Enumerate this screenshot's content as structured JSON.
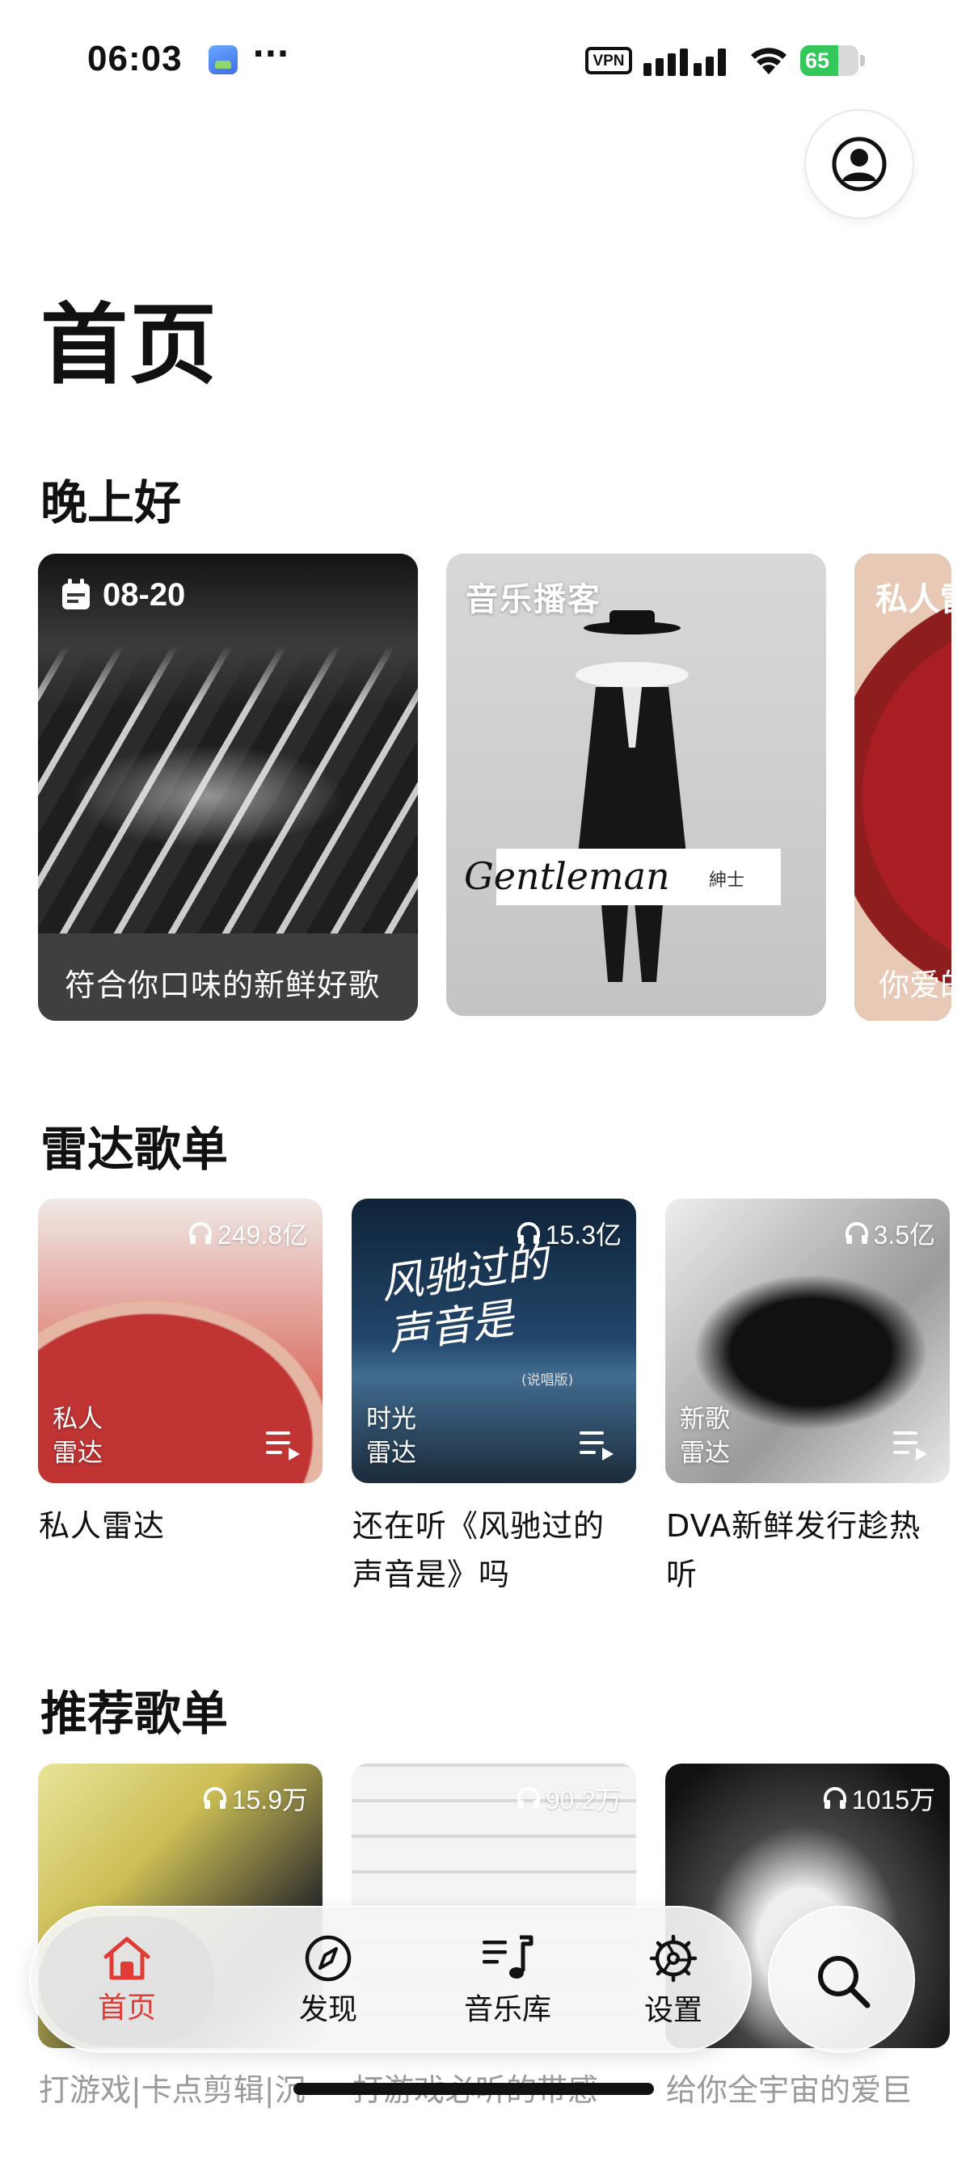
{
  "status_bar": {
    "time": "06:03",
    "more": "···",
    "vpn": "VPN",
    "battery_percent": 65,
    "battery_text": "65"
  },
  "header": {
    "title": "首页",
    "profile_icon": "person-circle-icon"
  },
  "greeting": {
    "title": "晚上好",
    "cards": [
      {
        "date": "08-20",
        "caption": "符合你口味的新鲜好歌"
      },
      {
        "label": "音乐播客",
        "art_text": "Gentleman",
        "art_text_cn": "紳士"
      },
      {
        "label": "私人雷达",
        "caption": "你爱的"
      }
    ]
  },
  "radar": {
    "title": "雷达歌单",
    "playlists": [
      {
        "plays": "249.8亿",
        "label_line1": "私人",
        "label_line2": "雷达",
        "title": "私人雷达"
      },
      {
        "plays": "15.3亿",
        "label_line1": "时光",
        "label_line2": "雷达",
        "title": "还在听《风驰过的声音是》吗",
        "art_line1": "风驰过的",
        "art_line2": "声音是",
        "art_note": "(说唱版)"
      },
      {
        "plays": "3.5亿",
        "label_line1": "新歌",
        "label_line2": "雷达",
        "title": "DVA新鲜发行趁热听"
      }
    ]
  },
  "recommended": {
    "title": "推荐歌单",
    "playlists": [
      {
        "plays": "15.9万",
        "caption": "打游戏|卡点剪辑|沉"
      },
      {
        "plays": "90.2万",
        "caption": "打游戏必听的带感"
      },
      {
        "plays": "1015万",
        "caption": "给你全宇宙的爱巨"
      }
    ]
  },
  "tabbar": {
    "items": [
      {
        "label": "首页",
        "icon": "home-icon",
        "active": true
      },
      {
        "label": "发现",
        "icon": "compass-icon"
      },
      {
        "label": "音乐库",
        "icon": "music-library-icon"
      },
      {
        "label": "设置",
        "icon": "settings-gear-icon"
      }
    ],
    "search_icon": "search-icon"
  },
  "colors": {
    "accent": "#e03b35",
    "battery": "#34c759"
  }
}
